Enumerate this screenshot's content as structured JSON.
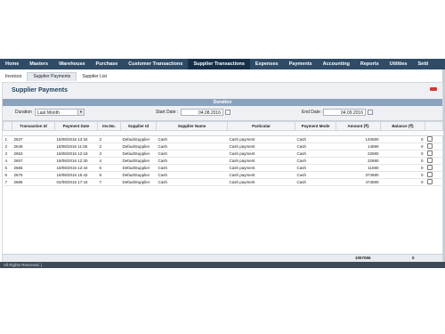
{
  "nav": {
    "items": [
      "Home",
      "Masters",
      "Warehouse",
      "Purchase",
      "Customer Transactions",
      "Supplier Transactions",
      "Expenses",
      "Payments",
      "Accounting",
      "Reports",
      "Utilities",
      "Setti"
    ]
  },
  "subtabs": [
    "Invoices",
    "Supplier Payments",
    "Supplier List"
  ],
  "page": {
    "title": "Supplier Payments"
  },
  "duration_bar": "Duration",
  "filters": {
    "duration_label": "Duration",
    "duration_value": "Last Month",
    "start_label": "Start Date :",
    "start_value": "04.08.2016",
    "end_label": "End Date :",
    "end_value": "04.09.2016"
  },
  "table": {
    "columns": [
      "",
      "Transaction Id",
      "Payment Date",
      "Inv.No.",
      "Supplier Id",
      "Supplier Name",
      "Particular",
      "Payment Mode",
      "Amount (₹)",
      "Balance (₹)",
      ""
    ],
    "rows": [
      [
        "1",
        "2637",
        "16/08/2016 13:34",
        "2",
        "DefaultSupplier",
        "Cash",
        "Cash payment",
        "Cash",
        "140690",
        "0"
      ],
      [
        "2",
        "2649",
        "18/08/2016 11:55",
        "2",
        "DefaultSupplier",
        "Cash",
        "Cash payment",
        "Cash",
        "14690",
        "0"
      ],
      [
        "3",
        "2653",
        "18/08/2016 12:18",
        "3",
        "DefaultSupplier",
        "Cash",
        "Cash payment",
        "Cash",
        "22690",
        "0"
      ],
      [
        "4",
        "2657",
        "18/08/2016 12:30",
        "4",
        "DefaultSupplier",
        "Cash",
        "Cash payment",
        "Cash",
        "22690",
        "0"
      ],
      [
        "5",
        "2665",
        "18/08/2016 12:44",
        "5",
        "DefaultSupplier",
        "Cash",
        "Cash payment",
        "Cash",
        "11690",
        "0"
      ],
      [
        "6",
        "2675",
        "18/08/2016 15:42",
        "6",
        "DefaultSupplier",
        "Cash",
        "Cash payment",
        "Cash",
        "374690",
        "0"
      ],
      [
        "7",
        "2686",
        "04/09/2016 17:44",
        "7",
        "DefaultSupplier",
        "Cash",
        "Cash payment",
        "Cash",
        "474690",
        "0"
      ]
    ]
  },
  "totals": {
    "amount": "1057056",
    "balance": "0"
  },
  "footer": "All Rights Reserved. |"
}
